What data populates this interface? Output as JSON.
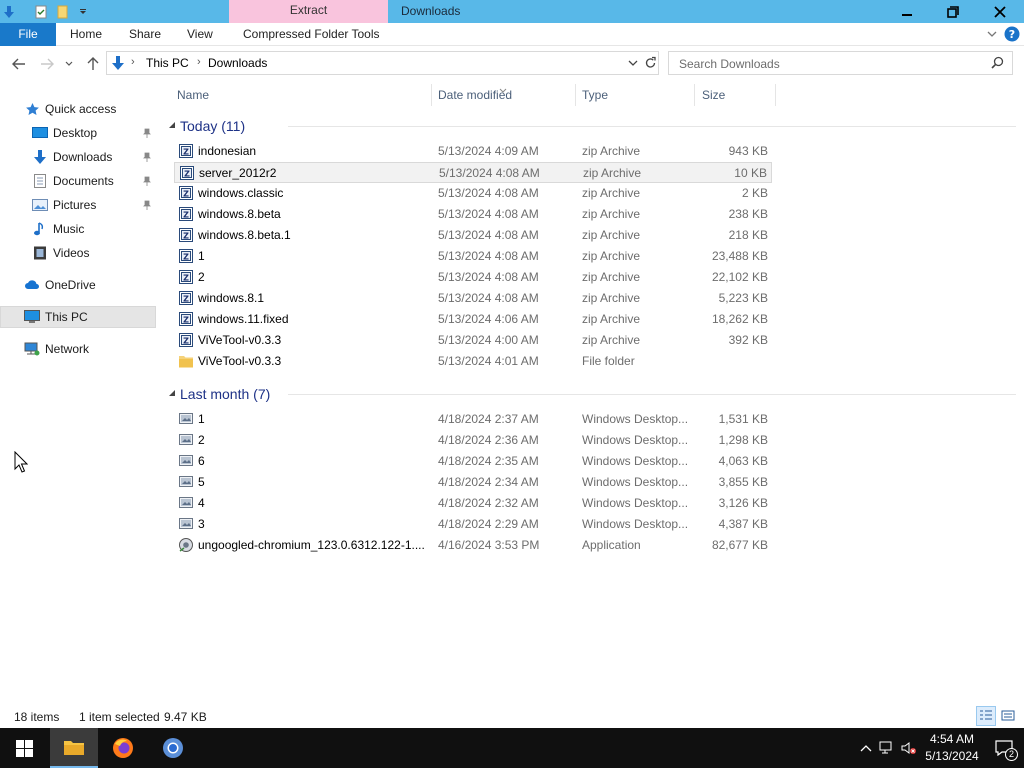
{
  "window": {
    "title": "Downloads",
    "contextual_tab_group": "Extract"
  },
  "ribbon": {
    "tabs": [
      {
        "label": "File"
      },
      {
        "label": "Home"
      },
      {
        "label": "Share"
      },
      {
        "label": "View"
      },
      {
        "label": "Compressed Folder Tools"
      }
    ]
  },
  "address": {
    "crumbs": [
      "This PC",
      "Downloads"
    ]
  },
  "search": {
    "placeholder": "Search Downloads"
  },
  "nav": {
    "quick_access": "Quick access",
    "items": [
      {
        "label": "Desktop",
        "icon": "desktop-icon",
        "pinned": true
      },
      {
        "label": "Downloads",
        "icon": "downloads-icon",
        "pinned": true
      },
      {
        "label": "Documents",
        "icon": "documents-icon",
        "pinned": true
      },
      {
        "label": "Pictures",
        "icon": "pictures-icon",
        "pinned": true
      },
      {
        "label": "Music",
        "icon": "music-icon",
        "pinned": false
      },
      {
        "label": "Videos",
        "icon": "videos-icon",
        "pinned": false
      }
    ],
    "onedrive": "OneDrive",
    "this_pc": "This PC",
    "network": "Network"
  },
  "columns": {
    "name": "Name",
    "date": "Date modified",
    "type": "Type",
    "size": "Size"
  },
  "groups": [
    {
      "title": "Today (11)",
      "files": [
        {
          "name": "indonesian",
          "date": "5/13/2024 4:09 AM",
          "type": "zip Archive",
          "size": "943 KB",
          "icon": "zip"
        },
        {
          "name": "server_2012r2",
          "date": "5/13/2024 4:08 AM",
          "type": "zip Archive",
          "size": "10 KB",
          "icon": "zip",
          "selected": true
        },
        {
          "name": "windows.classic",
          "date": "5/13/2024 4:08 AM",
          "type": "zip Archive",
          "size": "2 KB",
          "icon": "zip"
        },
        {
          "name": "windows.8.beta",
          "date": "5/13/2024 4:08 AM",
          "type": "zip Archive",
          "size": "238 KB",
          "icon": "zip"
        },
        {
          "name": "windows.8.beta.1",
          "date": "5/13/2024 4:08 AM",
          "type": "zip Archive",
          "size": "218 KB",
          "icon": "zip"
        },
        {
          "name": "1",
          "date": "5/13/2024 4:08 AM",
          "type": "zip Archive",
          "size": "23,488 KB",
          "icon": "zip"
        },
        {
          "name": "2",
          "date": "5/13/2024 4:08 AM",
          "type": "zip Archive",
          "size": "22,102 KB",
          "icon": "zip"
        },
        {
          "name": "windows.8.1",
          "date": "5/13/2024 4:08 AM",
          "type": "zip Archive",
          "size": "5,223 KB",
          "icon": "zip"
        },
        {
          "name": "windows.11.fixed",
          "date": "5/13/2024 4:06 AM",
          "type": "zip Archive",
          "size": "18,262 KB",
          "icon": "zip"
        },
        {
          "name": "ViVeTool-v0.3.3",
          "date": "5/13/2024 4:00 AM",
          "type": "zip Archive",
          "size": "392 KB",
          "icon": "zip"
        },
        {
          "name": "ViVeTool-v0.3.3",
          "date": "5/13/2024 4:01 AM",
          "type": "File folder",
          "size": "",
          "icon": "folder"
        }
      ]
    },
    {
      "title": "Last month (7)",
      "files": [
        {
          "name": "1",
          "date": "4/18/2024 2:37 AM",
          "type": "Windows Desktop...",
          "size": "1,531 KB",
          "icon": "theme"
        },
        {
          "name": "2",
          "date": "4/18/2024 2:36 AM",
          "type": "Windows Desktop...",
          "size": "1,298 KB",
          "icon": "theme"
        },
        {
          "name": "6",
          "date": "4/18/2024 2:35 AM",
          "type": "Windows Desktop...",
          "size": "4,063 KB",
          "icon": "theme"
        },
        {
          "name": "5",
          "date": "4/18/2024 2:34 AM",
          "type": "Windows Desktop...",
          "size": "3,855 KB",
          "icon": "theme"
        },
        {
          "name": "4",
          "date": "4/18/2024 2:32 AM",
          "type": "Windows Desktop...",
          "size": "3,126 KB",
          "icon": "theme"
        },
        {
          "name": "3",
          "date": "4/18/2024 2:29 AM",
          "type": "Windows Desktop...",
          "size": "4,387 KB",
          "icon": "theme"
        },
        {
          "name": "ungoogled-chromium_123.0.6312.122-1....",
          "date": "4/16/2024 3:53 PM",
          "type": "Application",
          "size": "82,677 KB",
          "icon": "app"
        }
      ]
    }
  ],
  "status": {
    "count": "18 items",
    "selected": "1 item selected",
    "size": "9.47 KB"
  },
  "taskbar": {
    "time": "4:54 AM",
    "date": "5/13/2024",
    "notifications": "2"
  }
}
